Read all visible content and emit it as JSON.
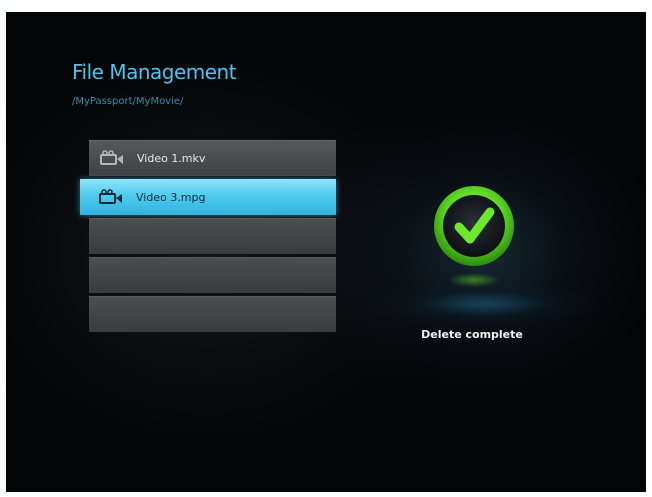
{
  "header": {
    "title": "File Management",
    "path": "/MyPassport/MyMovie/"
  },
  "file_list": {
    "items": [
      {
        "name": "Video 1.mkv",
        "icon": "video-camera-icon",
        "selected": false
      },
      {
        "name": "Video 3.mpg",
        "icon": "video-camera-icon",
        "selected": true
      }
    ],
    "empty_rows": 3
  },
  "dialog": {
    "icon": "checkmark-icon",
    "message": "Delete complete"
  },
  "colors": {
    "accent": "#4fc3ef",
    "selection": "#4fcbee",
    "success": "#5bd622",
    "background": "#030405"
  }
}
